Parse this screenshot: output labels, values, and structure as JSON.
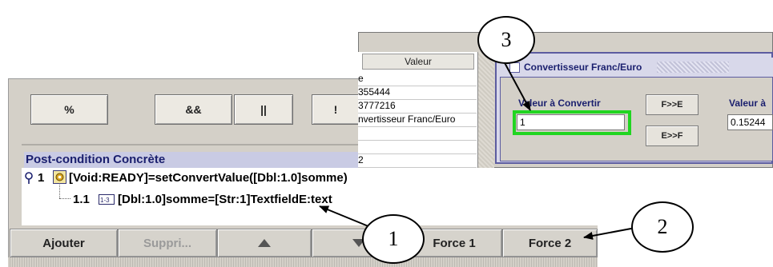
{
  "operators": [
    "%",
    "&&",
    "||",
    "!"
  ],
  "post_condition": {
    "title": "Post-condition Concrète",
    "node1_index": "1",
    "node1_text": "[Void:READY]=setConvertValue([Dbl:1.0]somme)",
    "node2_index": "1.1",
    "node2_text": "[Dbl:1.0]somme=[Str:1]TextfieldE:text"
  },
  "bottom_buttons": {
    "add": "Ajouter",
    "delete": "Suppri...",
    "force1": "Force 1",
    "force2": "Force 2"
  },
  "table": {
    "header": "Valeur",
    "rows": [
      "e",
      "355444",
      "3777216",
      "nvertisseur Franc/Euro",
      "",
      "",
      "2"
    ]
  },
  "converter": {
    "title": "Convertisseur Franc/Euro",
    "input_label": "Valeur à Convertir",
    "input_value": "1",
    "btn_f_to_e": "F>>E",
    "btn_e_to_f": "E>>F",
    "result_label": "Valeur à",
    "result_value": "0.15244"
  },
  "callouts": [
    "1",
    "2",
    "3"
  ]
}
